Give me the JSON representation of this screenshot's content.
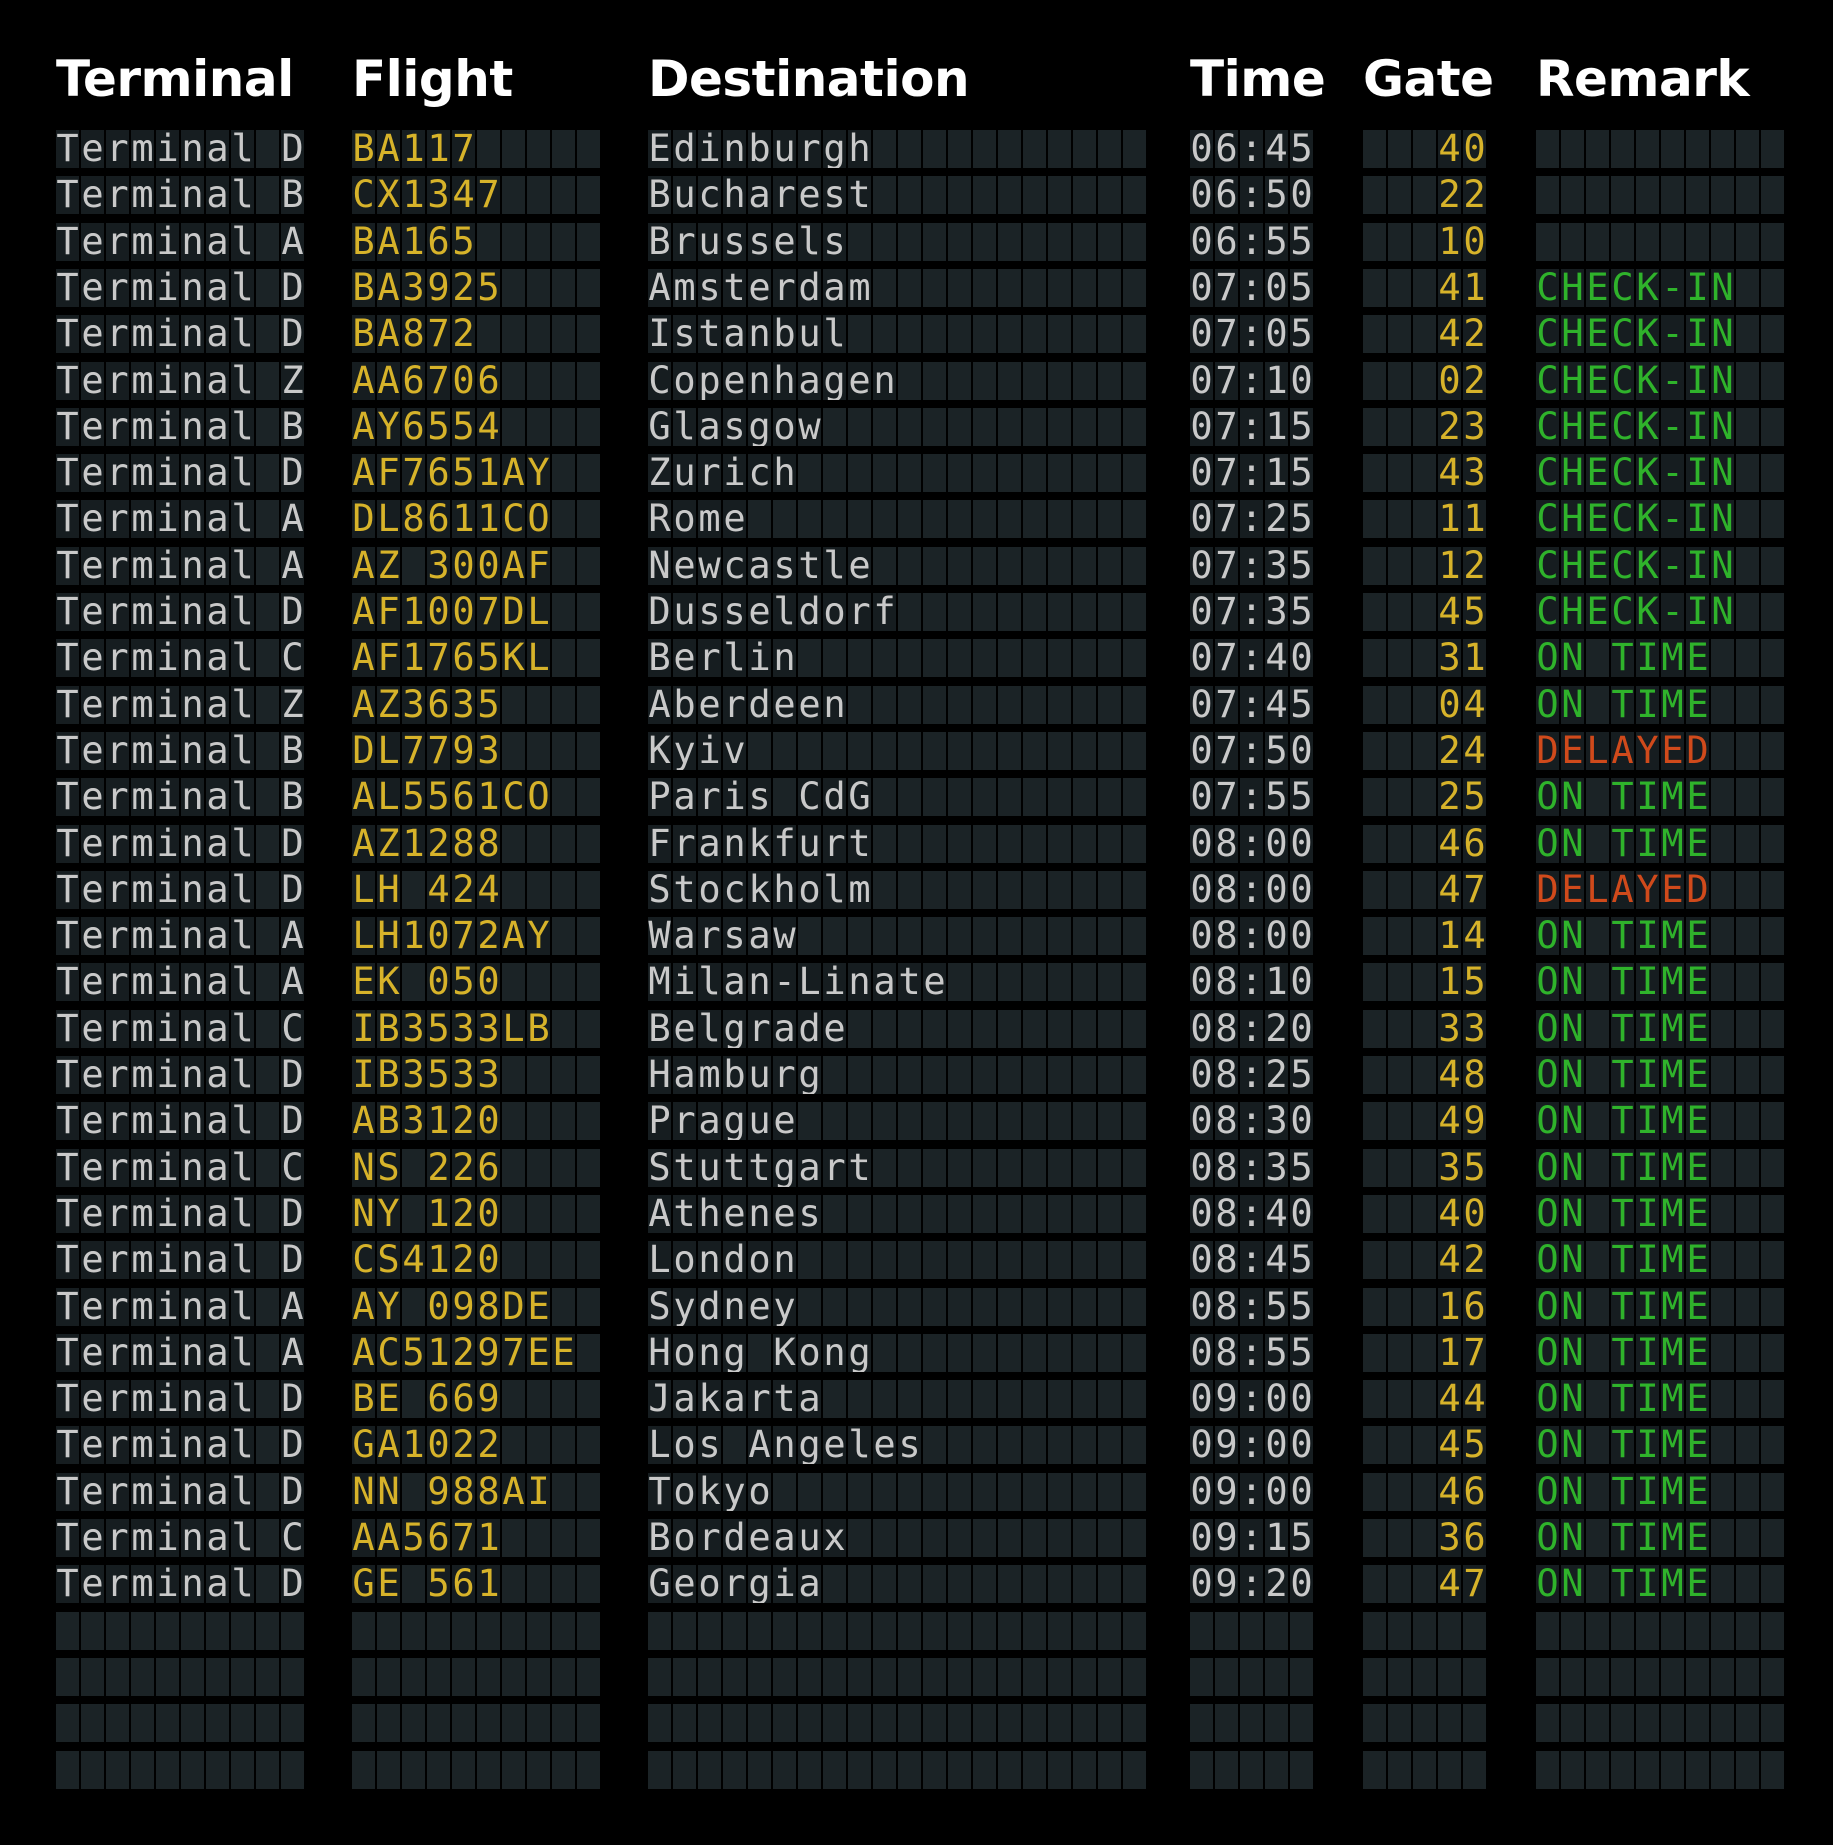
{
  "colors": {
    "background": "#000000",
    "header_text": "#ffffff",
    "terminal_text": "#c9c9c9",
    "flight_text": "#d7b32a",
    "destination_text": "#c9c9c9",
    "time_text": "#c9c9c9",
    "gate_text": "#d7b32a",
    "check_in": "#2fb32b",
    "on_time": "#2fb32b",
    "delayed": "#d04a1b",
    "tile": "#1b2326"
  },
  "headers": {
    "terminal": "Terminal",
    "flight": "Flight",
    "destination": "Destination",
    "time": "Time",
    "gate": "Gate",
    "remark": "Remark"
  },
  "flights": [
    {
      "terminal": "Terminal D",
      "flight": "BA117",
      "destination": "Edinburgh",
      "time": "06:45",
      "gate": "40",
      "remark": ""
    },
    {
      "terminal": "Terminal B",
      "flight": "CX1347",
      "destination": "Bucharest",
      "time": "06:50",
      "gate": "22",
      "remark": ""
    },
    {
      "terminal": "Terminal A",
      "flight": "BA165",
      "destination": "Brussels",
      "time": "06:55",
      "gate": "10",
      "remark": ""
    },
    {
      "terminal": "Terminal D",
      "flight": "BA3925",
      "destination": "Amsterdam",
      "time": "07:05",
      "gate": "41",
      "remark": "CHECK-IN"
    },
    {
      "terminal": "Terminal D",
      "flight": "BA872",
      "destination": "Istanbul",
      "time": "07:05",
      "gate": "42",
      "remark": "CHECK-IN"
    },
    {
      "terminal": "Terminal Z",
      "flight": "AA6706",
      "destination": "Copenhagen",
      "time": "07:10",
      "gate": "02",
      "remark": "CHECK-IN"
    },
    {
      "terminal": "Terminal B",
      "flight": "AY6554",
      "destination": "Glasgow",
      "time": "07:15",
      "gate": "23",
      "remark": "CHECK-IN"
    },
    {
      "terminal": "Terminal D",
      "flight": "AF7651AY",
      "destination": "Zurich",
      "time": "07:15",
      "gate": "43",
      "remark": "CHECK-IN"
    },
    {
      "terminal": "Terminal A",
      "flight": "DL8611CO",
      "destination": "Rome",
      "time": "07:25",
      "gate": "11",
      "remark": "CHECK-IN"
    },
    {
      "terminal": "Terminal A",
      "flight": "AZ 300AF",
      "destination": "Newcastle",
      "time": "07:35",
      "gate": "12",
      "remark": "CHECK-IN"
    },
    {
      "terminal": "Terminal D",
      "flight": "AF1007DL",
      "destination": "Dusseldorf",
      "time": "07:35",
      "gate": "45",
      "remark": "CHECK-IN"
    },
    {
      "terminal": "Terminal C",
      "flight": "AF1765KL",
      "destination": "Berlin",
      "time": "07:40",
      "gate": "31",
      "remark": "ON TIME"
    },
    {
      "terminal": "Terminal Z",
      "flight": "AZ3635",
      "destination": "Aberdeen",
      "time": "07:45",
      "gate": "04",
      "remark": "ON TIME"
    },
    {
      "terminal": "Terminal B",
      "flight": "DL7793",
      "destination": "Kyiv",
      "time": "07:50",
      "gate": "24",
      "remark": "DELAYED"
    },
    {
      "terminal": "Terminal B",
      "flight": "AL5561CO",
      "destination": "Paris CdG",
      "time": "07:55",
      "gate": "25",
      "remark": "ON TIME"
    },
    {
      "terminal": "Terminal D",
      "flight": "AZ1288",
      "destination": "Frankfurt",
      "time": "08:00",
      "gate": "46",
      "remark": "ON TIME"
    },
    {
      "terminal": "Terminal D",
      "flight": "LH 424",
      "destination": "Stockholm",
      "time": "08:00",
      "gate": "47",
      "remark": "DELAYED"
    },
    {
      "terminal": "Terminal A",
      "flight": "LH1072AY",
      "destination": "Warsaw",
      "time": "08:00",
      "gate": "14",
      "remark": "ON TIME"
    },
    {
      "terminal": "Terminal A",
      "flight": "EK 050",
      "destination": "Milan-Linate",
      "time": "08:10",
      "gate": "15",
      "remark": "ON TIME"
    },
    {
      "terminal": "Terminal C",
      "flight": "IB3533LB",
      "destination": "Belgrade",
      "time": "08:20",
      "gate": "33",
      "remark": "ON TIME"
    },
    {
      "terminal": "Terminal D",
      "flight": "IB3533",
      "destination": "Hamburg",
      "time": "08:25",
      "gate": "48",
      "remark": "ON TIME"
    },
    {
      "terminal": "Terminal D",
      "flight": "AB3120",
      "destination": "Prague",
      "time": "08:30",
      "gate": "49",
      "remark": "ON TIME"
    },
    {
      "terminal": "Terminal C",
      "flight": "NS 226",
      "destination": "Stuttgart",
      "time": "08:35",
      "gate": "35",
      "remark": "ON TIME"
    },
    {
      "terminal": "Terminal D",
      "flight": "NY 120",
      "destination": "Athenes",
      "time": "08:40",
      "gate": "40",
      "remark": "ON TIME"
    },
    {
      "terminal": "Terminal D",
      "flight": "CS4120",
      "destination": "London",
      "time": "08:45",
      "gate": "42",
      "remark": "ON TIME"
    },
    {
      "terminal": "Terminal A",
      "flight": "AY 098DE",
      "destination": "Sydney",
      "time": "08:55",
      "gate": "16",
      "remark": "ON TIME"
    },
    {
      "terminal": "Terminal A",
      "flight": "AC51297EE",
      "destination": "Hong Kong",
      "time": "08:55",
      "gate": "17",
      "remark": "ON TIME"
    },
    {
      "terminal": "Terminal D",
      "flight": "BE 669",
      "destination": "Jakarta",
      "time": "09:00",
      "gate": "44",
      "remark": "ON TIME"
    },
    {
      "terminal": "Terminal D",
      "flight": "GA1022",
      "destination": "Los Angeles",
      "time": "09:00",
      "gate": "45",
      "remark": "ON TIME"
    },
    {
      "terminal": "Terminal D",
      "flight": "NN 988AI",
      "destination": "Tokyo",
      "time": "09:00",
      "gate": "46",
      "remark": "ON TIME"
    },
    {
      "terminal": "Terminal C",
      "flight": "AA5671",
      "destination": "Bordeaux",
      "time": "09:15",
      "gate": "36",
      "remark": "ON TIME"
    },
    {
      "terminal": "Terminal D",
      "flight": "GE 561",
      "destination": "Georgia",
      "time": "09:20",
      "gate": "47",
      "remark": "ON TIME"
    }
  ],
  "empty_rows": 4
}
